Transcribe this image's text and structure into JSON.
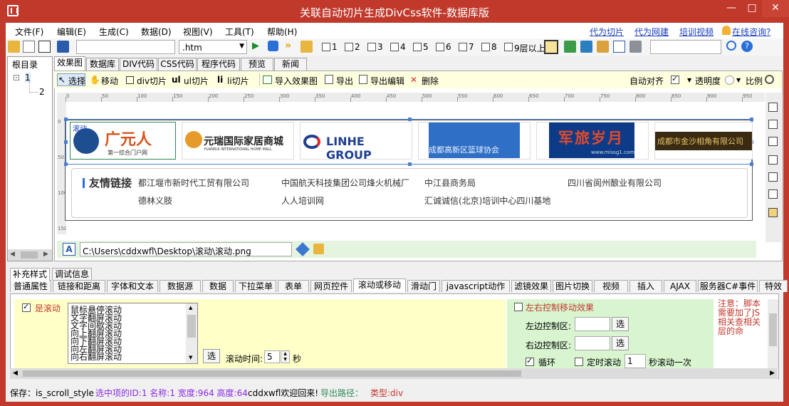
{
  "window": {
    "title": "关联自动切片生成DivCss软件-数据库版",
    "min": "—",
    "max": "□",
    "close": "✕"
  },
  "menu": [
    "文件(F)",
    "编辑(E)",
    "生成(C)",
    "数据(D)",
    "视图(V)",
    "工具(T)",
    "帮助(H)"
  ],
  "toplinks": [
    "代为切片",
    "代为网建",
    "培训视频",
    "在线咨询?"
  ],
  "toolbar": {
    "ext_value": ".htm",
    "layers": [
      "1",
      "2",
      "3",
      "4",
      "5",
      "6",
      "7",
      "8",
      "9层以上"
    ]
  },
  "tree": {
    "root": "根目录",
    "item1": "1",
    "item2": "2"
  },
  "tabs": [
    "效果图",
    "数据库",
    "DIV代码",
    "CSS代码",
    "程序代码",
    "预览",
    "新闻"
  ],
  "editbar": {
    "select": "选择",
    "move": "移动",
    "div": "div切片",
    "ul": "ul切片",
    "li": "li切片",
    "import": "导入效果图",
    "export": "导出",
    "export_edit": "导出编辑",
    "delete": "删除",
    "auto_align": "自动对齐",
    "opacity": "透明度",
    "ratio": "比例"
  },
  "ruler": {
    "h": [
      "0",
      "50",
      "100",
      "150",
      "200",
      "250",
      "300",
      "350",
      "400",
      "450",
      "500",
      "550",
      "600",
      "650",
      "700",
      "750",
      "800",
      "850",
      "900",
      "950"
    ],
    "v": [
      "0",
      "50",
      "100",
      "150"
    ]
  },
  "logos": [
    {
      "text": "广元人",
      "sub": "第一综合门户网"
    },
    {
      "text": "元瑞国际家居商城",
      "sub": "YUANRUI INTERNATIONAL HOME MALL"
    },
    {
      "text": "LINHE GROUP",
      "sub": ""
    },
    {
      "text": "成都高新区篮球协会",
      "sub": ""
    },
    {
      "text": "军旅岁月",
      "sub": "www.missg1.com"
    },
    {
      "text": "成都市金沙相角有限公司",
      "sub": ""
    }
  ],
  "logo_overlay": "滚动",
  "friends": {
    "title": "友情链接",
    "links": [
      "都江堰市新时代工贸有限公司",
      "中国航天科技集团公司烽火机械厂",
      "中江县商务局",
      "四川省阆州酿业有限公司",
      "德林义肢",
      "人人培训网",
      "汇诚诚信(北京)培训中心四川基地"
    ]
  },
  "path": "C:\\Users\\cddxwfl\\Desktop\\滚动\\滚动.png",
  "proptabs_top": [
    "补充样式",
    "调试信息"
  ],
  "proptabs": [
    "普通属性",
    "链接和距离",
    "字体和文本",
    "数据源",
    "数据",
    "下拉菜单",
    "表单",
    "网页控件",
    "滚动或移动",
    "滑动门",
    "javascript动作",
    "滤镜效果",
    "图片切换",
    "视频",
    "插入",
    "AJAX",
    "服务器C#事件",
    "特效"
  ],
  "scroll": {
    "is_scroll": "是滚动",
    "options": [
      "鼠标悬停滚动",
      "文字翻屏滚动",
      "文字间歇滚动",
      "向上翻屏滚动",
      "向下翻屏滚动",
      "向左翻屏滚动",
      "向右翻屏滚动"
    ],
    "select_btn": "选",
    "time_label": "滚动时间:",
    "time_value": "5",
    "time_unit": "秒"
  },
  "lr": {
    "title": "左右控制移动效果",
    "left_label": "左边控制区:",
    "right_label": "右边控制区:",
    "select_btn": "选",
    "loop": "循环",
    "timed": "定时滚动",
    "timed_value": "1",
    "timed_unit": "秒滚动一次"
  },
  "note": "注意：脚本需要加了JS相关查相关层的命",
  "status": {
    "save": "保存：is_scroll_style",
    "selected": "选中项的ID:1 名称:1 宽度:964 高度:64",
    "welcome": "cddxwfl欢迎回来!",
    "export_path": "导出路径：",
    "type": "类型:div"
  },
  "colors": {
    "title_bar": "#c0392b",
    "yellow_panel": "#ffffc8",
    "green_panel": "#d8f5d0",
    "link_blue": "#1a3fbf"
  }
}
